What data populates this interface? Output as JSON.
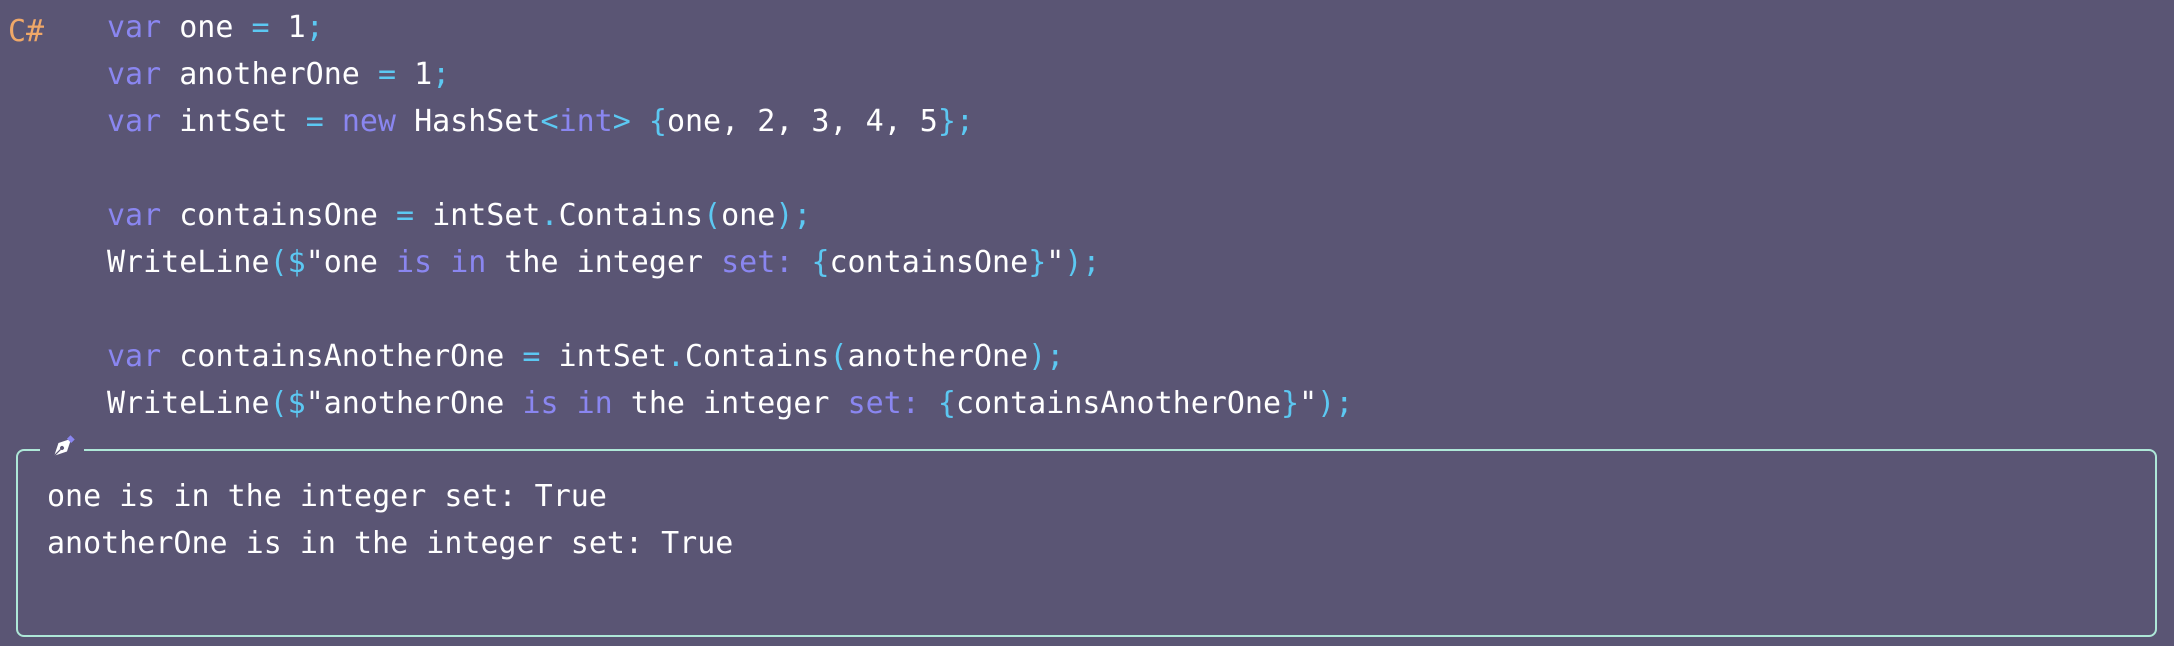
{
  "cell": {
    "language_label": "C#"
  },
  "code_lines": [
    [
      {
        "t": "var",
        "k": "keyword"
      },
      {
        "t": " "
      },
      {
        "t": "one",
        "k": "ident"
      },
      {
        "t": " "
      },
      {
        "t": "=",
        "k": "op"
      },
      {
        "t": " "
      },
      {
        "t": "1",
        "k": "num"
      },
      {
        "t": ";",
        "k": "op"
      }
    ],
    [
      {
        "t": "var",
        "k": "keyword"
      },
      {
        "t": " "
      },
      {
        "t": "anotherOne",
        "k": "ident"
      },
      {
        "t": " "
      },
      {
        "t": "=",
        "k": "op"
      },
      {
        "t": " "
      },
      {
        "t": "1",
        "k": "num"
      },
      {
        "t": ";",
        "k": "op"
      }
    ],
    [
      {
        "t": "var",
        "k": "keyword"
      },
      {
        "t": " "
      },
      {
        "t": "intSet",
        "k": "ident"
      },
      {
        "t": " "
      },
      {
        "t": "=",
        "k": "op"
      },
      {
        "t": " "
      },
      {
        "t": "new",
        "k": "keyword"
      },
      {
        "t": " "
      },
      {
        "t": "HashSet",
        "k": "ident"
      },
      {
        "t": "<",
        "k": "op"
      },
      {
        "t": "int",
        "k": "keyword"
      },
      {
        "t": ">",
        "k": "op"
      },
      {
        "t": " "
      },
      {
        "t": "{",
        "k": "op"
      },
      {
        "t": "one, 2, 3, 4, 5",
        "k": "ident"
      },
      {
        "t": "};",
        "k": "op"
      }
    ],
    [],
    [
      {
        "t": "var",
        "k": "keyword"
      },
      {
        "t": " "
      },
      {
        "t": "containsOne",
        "k": "ident"
      },
      {
        "t": " "
      },
      {
        "t": "=",
        "k": "op"
      },
      {
        "t": " "
      },
      {
        "t": "intSet",
        "k": "ident"
      },
      {
        "t": ".",
        "k": "op"
      },
      {
        "t": "Contains",
        "k": "ident"
      },
      {
        "t": "(",
        "k": "op"
      },
      {
        "t": "one",
        "k": "ident"
      },
      {
        "t": ");",
        "k": "op"
      }
    ],
    [
      {
        "t": "WriteLine",
        "k": "ident"
      },
      {
        "t": "(",
        "k": "op"
      },
      {
        "t": "$",
        "k": "dollar"
      },
      {
        "t": "\"one ",
        "k": "str"
      },
      {
        "t": "is",
        "k": "keyword"
      },
      {
        "t": " "
      },
      {
        "t": "in",
        "k": "keyword"
      },
      {
        "t": " the integer ",
        "k": "str"
      },
      {
        "t": "set:",
        "k": "keyword"
      },
      {
        "t": " "
      },
      {
        "t": "{",
        "k": "op"
      },
      {
        "t": "containsOne",
        "k": "ident"
      },
      {
        "t": "}",
        "k": "op"
      },
      {
        "t": "\"",
        "k": "str"
      },
      {
        "t": ");",
        "k": "op"
      }
    ],
    [],
    [
      {
        "t": "var",
        "k": "keyword"
      },
      {
        "t": " "
      },
      {
        "t": "containsAnotherOne",
        "k": "ident"
      },
      {
        "t": " "
      },
      {
        "t": "=",
        "k": "op"
      },
      {
        "t": " "
      },
      {
        "t": "intSet",
        "k": "ident"
      },
      {
        "t": ".",
        "k": "op"
      },
      {
        "t": "Contains",
        "k": "ident"
      },
      {
        "t": "(",
        "k": "op"
      },
      {
        "t": "anotherOne",
        "k": "ident"
      },
      {
        "t": ");",
        "k": "op"
      }
    ],
    [
      {
        "t": "WriteLine",
        "k": "ident"
      },
      {
        "t": "(",
        "k": "op"
      },
      {
        "t": "$",
        "k": "dollar"
      },
      {
        "t": "\"anotherOne ",
        "k": "str"
      },
      {
        "t": "is",
        "k": "keyword"
      },
      {
        "t": " "
      },
      {
        "t": "in",
        "k": "keyword"
      },
      {
        "t": " the integer ",
        "k": "str"
      },
      {
        "t": "set:",
        "k": "keyword"
      },
      {
        "t": " "
      },
      {
        "t": "{",
        "k": "op"
      },
      {
        "t": "containsAnotherOne",
        "k": "ident"
      },
      {
        "t": "}",
        "k": "op"
      },
      {
        "t": "\"",
        "k": "str"
      },
      {
        "t": ");",
        "k": "op"
      }
    ]
  ],
  "output": {
    "icon": "pen-nib-icon",
    "lines": [
      "one is in the integer set: True",
      "anotherOne is in the integer set: True"
    ]
  },
  "colors": {
    "background": "#5a5574",
    "keyword": "#8a86f0",
    "operator": "#5cc8f2",
    "text": "#ffffff",
    "language_label": "#f0a868",
    "output_border": "#aee8d8"
  }
}
